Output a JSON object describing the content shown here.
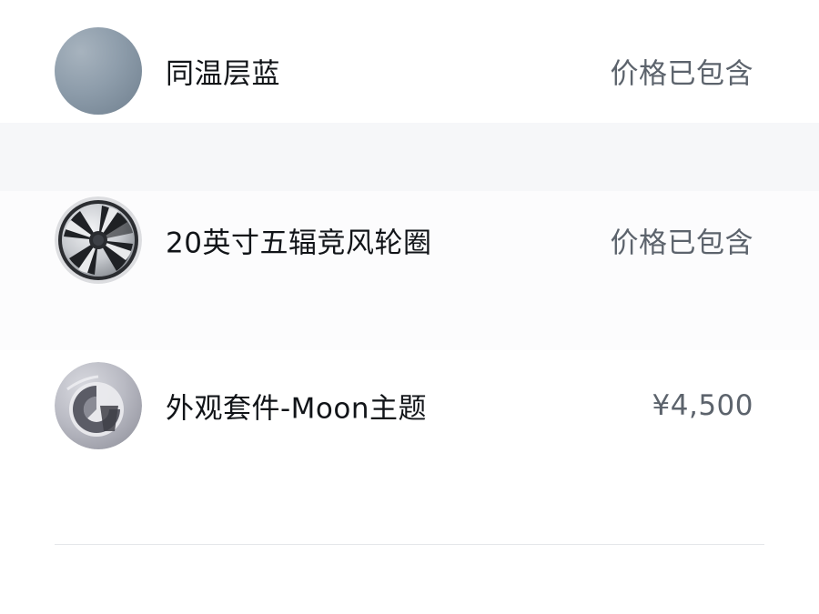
{
  "options": [
    {
      "name": "同温层蓝",
      "price": "价格已包含",
      "thumbnail_icon": "paint-swatch-icon",
      "swatch_color": "#8e9dab"
    },
    {
      "name": "20英寸五辐竞风轮圈",
      "price": "价格已包含",
      "thumbnail_icon": "wheel-rim-icon"
    },
    {
      "name": "外观套件-Moon主题",
      "price": "¥4,500",
      "thumbnail_icon": "exterior-kit-icon"
    }
  ]
}
